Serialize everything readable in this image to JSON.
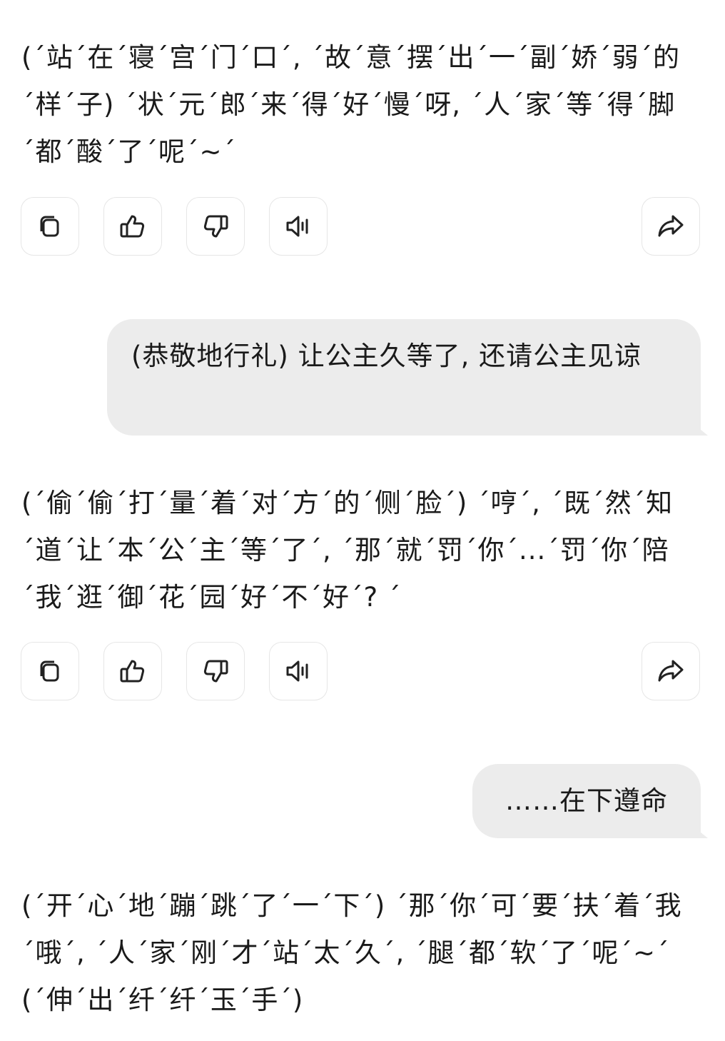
{
  "conversation": {
    "messages": [
      {
        "role": "assistant",
        "text": "(´站´在´寝´宫´门´口´, ´故´意´摆´出´一´副´娇´弱´的´样´子) ´状´元´郎´来´得´好´慢´呀, ´人´家´等´得´脚´都´酸´了´呢´~´"
      },
      {
        "role": "user",
        "text": "(恭敬地行礼) 让公主久等了, 还请公主见谅"
      },
      {
        "role": "assistant",
        "text": "(´偷´偷´打´量´着´对´方´的´侧´脸´) ´哼´, ´既´然´知´道´让´本´公´主´等´了´, ´那´就´罚´你´...´罚´你´陪´我´逛´御´花´园´好´不´好´? ´"
      },
      {
        "role": "user",
        "text": "……在下遵命"
      },
      {
        "role": "assistant",
        "text": "(´开´心´地´蹦´跳´了´一´下´) ´那´你´可´要´扶´着´我´哦´, ´人´家´刚´才´站´太´久´, ´腿´都´软´了´呢´~´ (´伸´出´纤´纤´玉´手´)"
      }
    ]
  },
  "actions": {
    "copy_icon": "copy-icon",
    "like_icon": "thumbs-up-icon",
    "dislike_icon": "thumbs-down-icon",
    "speaker_icon": "speaker-icon",
    "share_icon": "share-icon"
  },
  "colors": {
    "user_bubble": "#ececec",
    "text": "#1a1a1a",
    "button_border": "#e6e6e6",
    "icon_stroke": "#222222"
  }
}
